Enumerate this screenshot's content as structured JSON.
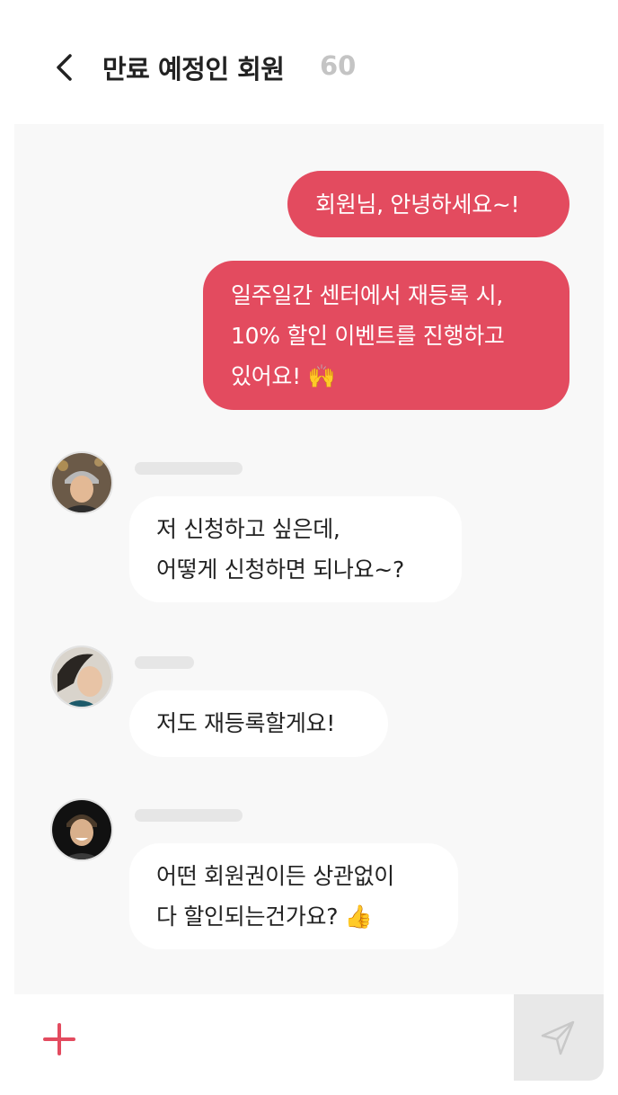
{
  "header": {
    "title": "만료 예정인 회원",
    "count": "60"
  },
  "messages": {
    "out_1": {
      "lines": [
        "회원님, 안녕하세요~!"
      ]
    },
    "out_2": {
      "lines": [
        "일주일간 센터에서 재등록 시,",
        "10% 할인 이벤트를 진행하고",
        "있어요!"
      ],
      "emoji": "🙌"
    },
    "in_1": {
      "lines": [
        "저 신청하고 싶은데,",
        "어떻게 신청하면 되나요~?"
      ]
    },
    "in_2": {
      "lines": [
        "저도 재등록할게요!"
      ]
    },
    "in_3": {
      "lines": [
        "어떤 회원권이든 상관없이",
        "다 할인되는건가요?"
      ],
      "emoji": "👍"
    }
  },
  "input": {
    "placeholder": ""
  },
  "icons": {
    "back": "chevron-left-icon",
    "plus": "plus-icon",
    "send": "send-icon"
  },
  "colors": {
    "accent": "#e34b5f",
    "chat_background": "#f8f8f8",
    "incoming_bubble": "#ffffff",
    "count_gray": "#c4c4c4",
    "send_button_bg": "#e8e8e8"
  }
}
